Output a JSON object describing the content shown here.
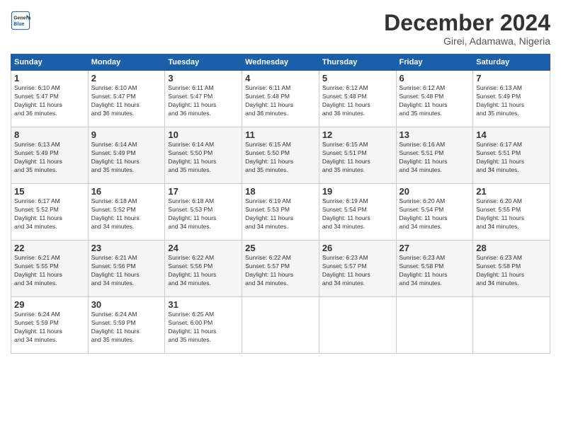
{
  "logo": {
    "line1": "General",
    "line2": "Blue"
  },
  "title": "December 2024",
  "subtitle": "Girei, Adamawa, Nigeria",
  "weekdays": [
    "Sunday",
    "Monday",
    "Tuesday",
    "Wednesday",
    "Thursday",
    "Friday",
    "Saturday"
  ],
  "rows": [
    [
      {
        "day": "1",
        "info": "Sunrise: 6:10 AM\nSunset: 5:47 PM\nDaylight: 11 hours\nand 36 minutes."
      },
      {
        "day": "2",
        "info": "Sunrise: 6:10 AM\nSunset: 5:47 PM\nDaylight: 11 hours\nand 36 minutes."
      },
      {
        "day": "3",
        "info": "Sunrise: 6:11 AM\nSunset: 5:47 PM\nDaylight: 11 hours\nand 36 minutes."
      },
      {
        "day": "4",
        "info": "Sunrise: 6:11 AM\nSunset: 5:48 PM\nDaylight: 11 hours\nand 36 minutes."
      },
      {
        "day": "5",
        "info": "Sunrise: 6:12 AM\nSunset: 5:48 PM\nDaylight: 11 hours\nand 36 minutes."
      },
      {
        "day": "6",
        "info": "Sunrise: 6:12 AM\nSunset: 5:48 PM\nDaylight: 11 hours\nand 35 minutes."
      },
      {
        "day": "7",
        "info": "Sunrise: 6:13 AM\nSunset: 5:49 PM\nDaylight: 11 hours\nand 35 minutes."
      }
    ],
    [
      {
        "day": "8",
        "info": "Sunrise: 6:13 AM\nSunset: 5:49 PM\nDaylight: 11 hours\nand 35 minutes."
      },
      {
        "day": "9",
        "info": "Sunrise: 6:14 AM\nSunset: 5:49 PM\nDaylight: 11 hours\nand 35 minutes."
      },
      {
        "day": "10",
        "info": "Sunrise: 6:14 AM\nSunset: 5:50 PM\nDaylight: 11 hours\nand 35 minutes."
      },
      {
        "day": "11",
        "info": "Sunrise: 6:15 AM\nSunset: 5:50 PM\nDaylight: 11 hours\nand 35 minutes."
      },
      {
        "day": "12",
        "info": "Sunrise: 6:15 AM\nSunset: 5:51 PM\nDaylight: 11 hours\nand 35 minutes."
      },
      {
        "day": "13",
        "info": "Sunrise: 6:16 AM\nSunset: 5:51 PM\nDaylight: 11 hours\nand 34 minutes."
      },
      {
        "day": "14",
        "info": "Sunrise: 6:17 AM\nSunset: 5:51 PM\nDaylight: 11 hours\nand 34 minutes."
      }
    ],
    [
      {
        "day": "15",
        "info": "Sunrise: 6:17 AM\nSunset: 5:52 PM\nDaylight: 11 hours\nand 34 minutes."
      },
      {
        "day": "16",
        "info": "Sunrise: 6:18 AM\nSunset: 5:52 PM\nDaylight: 11 hours\nand 34 minutes."
      },
      {
        "day": "17",
        "info": "Sunrise: 6:18 AM\nSunset: 5:53 PM\nDaylight: 11 hours\nand 34 minutes."
      },
      {
        "day": "18",
        "info": "Sunrise: 6:19 AM\nSunset: 5:53 PM\nDaylight: 11 hours\nand 34 minutes."
      },
      {
        "day": "19",
        "info": "Sunrise: 6:19 AM\nSunset: 5:54 PM\nDaylight: 11 hours\nand 34 minutes."
      },
      {
        "day": "20",
        "info": "Sunrise: 6:20 AM\nSunset: 5:54 PM\nDaylight: 11 hours\nand 34 minutes."
      },
      {
        "day": "21",
        "info": "Sunrise: 6:20 AM\nSunset: 5:55 PM\nDaylight: 11 hours\nand 34 minutes."
      }
    ],
    [
      {
        "day": "22",
        "info": "Sunrise: 6:21 AM\nSunset: 5:55 PM\nDaylight: 11 hours\nand 34 minutes."
      },
      {
        "day": "23",
        "info": "Sunrise: 6:21 AM\nSunset: 5:56 PM\nDaylight: 11 hours\nand 34 minutes."
      },
      {
        "day": "24",
        "info": "Sunrise: 6:22 AM\nSunset: 5:56 PM\nDaylight: 11 hours\nand 34 minutes."
      },
      {
        "day": "25",
        "info": "Sunrise: 6:22 AM\nSunset: 5:57 PM\nDaylight: 11 hours\nand 34 minutes."
      },
      {
        "day": "26",
        "info": "Sunrise: 6:23 AM\nSunset: 5:57 PM\nDaylight: 11 hours\nand 34 minutes."
      },
      {
        "day": "27",
        "info": "Sunrise: 6:23 AM\nSunset: 5:58 PM\nDaylight: 11 hours\nand 34 minutes."
      },
      {
        "day": "28",
        "info": "Sunrise: 6:23 AM\nSunset: 5:58 PM\nDaylight: 11 hours\nand 34 minutes."
      }
    ],
    [
      {
        "day": "29",
        "info": "Sunrise: 6:24 AM\nSunset: 5:59 PM\nDaylight: 11 hours\nand 34 minutes."
      },
      {
        "day": "30",
        "info": "Sunrise: 6:24 AM\nSunset: 5:59 PM\nDaylight: 11 hours\nand 35 minutes."
      },
      {
        "day": "31",
        "info": "Sunrise: 6:25 AM\nSunset: 6:00 PM\nDaylight: 11 hours\nand 35 minutes."
      },
      null,
      null,
      null,
      null
    ]
  ]
}
